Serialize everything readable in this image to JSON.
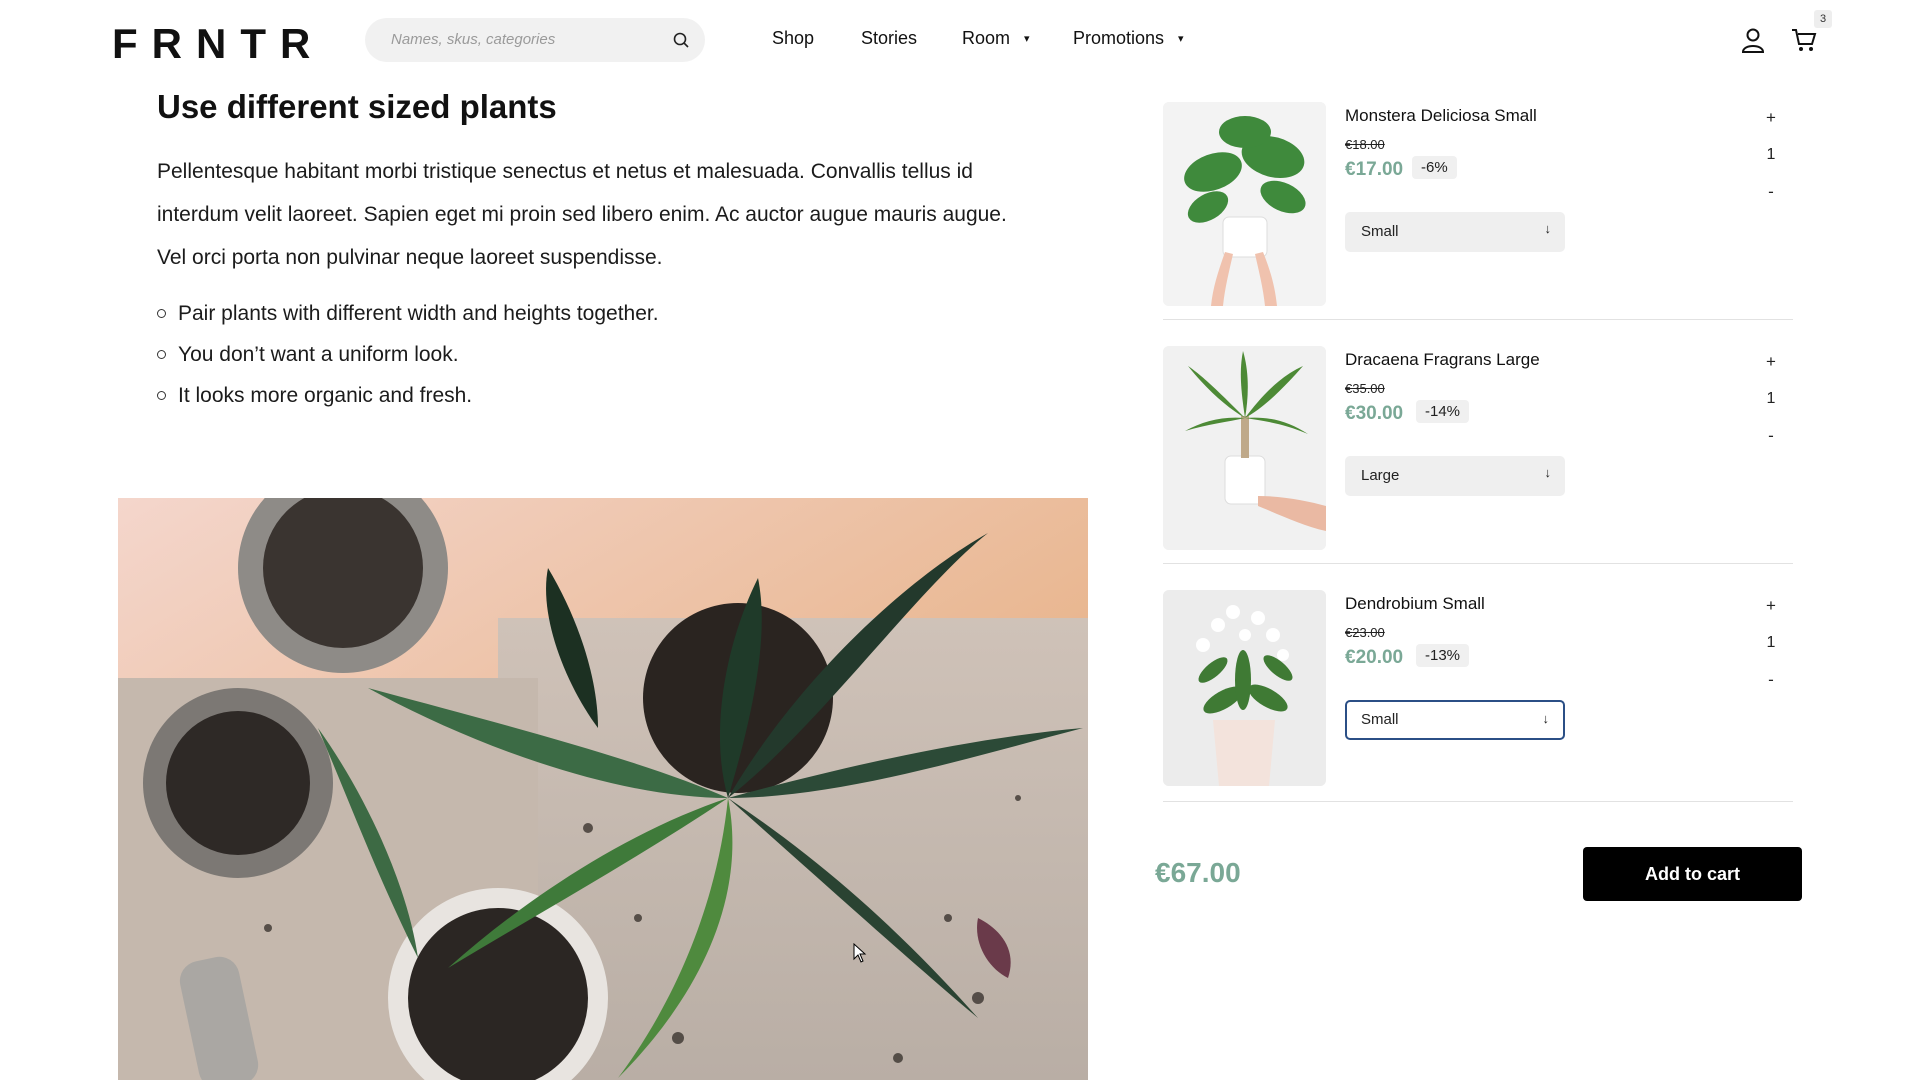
{
  "header": {
    "logo": "FRNTR",
    "search_placeholder": "Names, skus, categories",
    "nav": [
      {
        "label": "Shop",
        "dropdown": false
      },
      {
        "label": "Stories",
        "dropdown": false
      },
      {
        "label": "Room",
        "dropdown": true
      },
      {
        "label": "Promotions",
        "dropdown": true
      }
    ],
    "caret": "▾",
    "cart_count": "3",
    "icons": [
      "search-icon",
      "user-icon",
      "cart-icon"
    ]
  },
  "article": {
    "heading": "Use different sized plants",
    "paragraph": "Pellentesque habitant morbi tristique senectus et netus et malesuada. Convallis tellus id interdum velit laoreet. Sapien eget mi proin sed libero enim. Ac auctor augue mauris augue. Vel orci porta non pulvinar neque laoreet suspendisse.",
    "bullets": [
      "Pair plants with different width and heights together.",
      "You don’t want a uniform look.",
      "It looks more organic and fresh."
    ]
  },
  "cart": {
    "items": [
      {
        "name": "Monstera Deliciosa Small",
        "old_price": "€18.00",
        "price": "€17.00",
        "discount": "-6%",
        "size": "Small",
        "quantity": "1"
      },
      {
        "name": "Dracaena Fragrans Large",
        "old_price": "€35.00",
        "price": "€30.00",
        "discount": "-14%",
        "size": "Large",
        "quantity": "1"
      },
      {
        "name": "Dendrobium Small",
        "old_price": "€23.00",
        "price": "€20.00",
        "discount": "-13%",
        "size": "Small",
        "quantity": "1"
      }
    ],
    "plus": "+",
    "minus": "-",
    "select_arrow": "↓",
    "total": "€67.00",
    "add_to_cart": "Add to cart"
  },
  "colors": {
    "accent_price": "#7aa896",
    "button": "#000000",
    "focus_border": "#2b4f86"
  }
}
